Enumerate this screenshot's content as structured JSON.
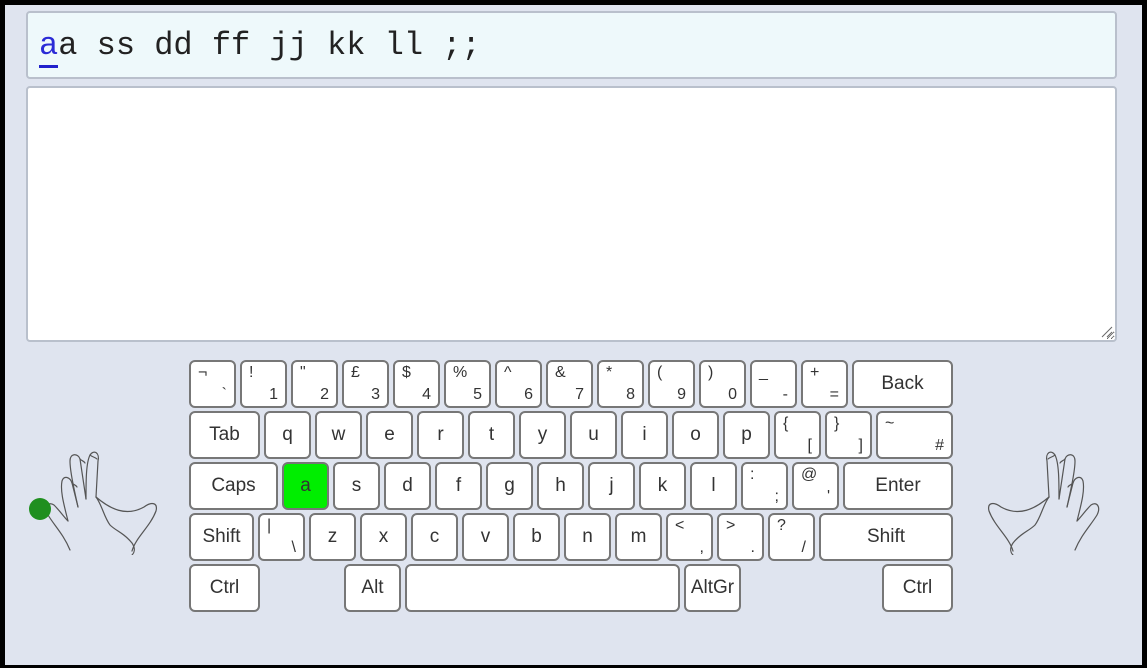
{
  "lesson": {
    "current_char": "a",
    "remaining_text": "a ss dd ff jj kk ll ;;"
  },
  "typing_area": {
    "value": ""
  },
  "keyboard": {
    "active_key": "a",
    "colors": {
      "active": "#00ee00",
      "finger_dot": "#1f8f1f"
    },
    "row1": [
      {
        "top": "¬",
        "bot": "`"
      },
      {
        "top": "!",
        "bot": "1"
      },
      {
        "top": "\"",
        "bot": "2"
      },
      {
        "top": "£",
        "bot": "3"
      },
      {
        "top": "$",
        "bot": "4"
      },
      {
        "top": "%",
        "bot": "5"
      },
      {
        "top": "^",
        "bot": "6"
      },
      {
        "top": "&",
        "bot": "7"
      },
      {
        "top": "*",
        "bot": "8"
      },
      {
        "top": "(",
        "bot": "9"
      },
      {
        "top": ")",
        "bot": "0"
      },
      {
        "top": "_",
        "bot": "-"
      },
      {
        "top": "+",
        "bot": "="
      }
    ],
    "back_label": "Back",
    "tab_label": "Tab",
    "row2": [
      "q",
      "w",
      "e",
      "r",
      "t",
      "y",
      "u",
      "i",
      "o",
      "p"
    ],
    "row2_dual": [
      {
        "top": "{",
        "bot": "["
      },
      {
        "top": "}",
        "bot": "]"
      },
      {
        "top": "~",
        "bot": "#"
      }
    ],
    "caps_label": "Caps",
    "row3": [
      "a",
      "s",
      "d",
      "f",
      "g",
      "h",
      "j",
      "k",
      "l"
    ],
    "row3_dual": [
      {
        "top": ":",
        "bot": ";"
      },
      {
        "top": "@",
        "bot": "'"
      }
    ],
    "enter_label": "Enter",
    "shift_left_label": "Shift",
    "row4_first": {
      "top": "|",
      "bot": "\\"
    },
    "row4": [
      "z",
      "x",
      "c",
      "v",
      "b",
      "n",
      "m"
    ],
    "row4_dual": [
      {
        "top": "<",
        "bot": ","
      },
      {
        "top": ">",
        "bot": "."
      },
      {
        "top": "?",
        "bot": "/"
      }
    ],
    "shift_right_label": "Shift",
    "ctrl_left_label": "Ctrl",
    "alt_label": "Alt",
    "space_label": "",
    "altgr_label": "AltGr",
    "ctrl_right_label": "Ctrl"
  },
  "hands": {
    "left_hand_icon": "left-hand-icon",
    "right_hand_icon": "right-hand-icon"
  }
}
